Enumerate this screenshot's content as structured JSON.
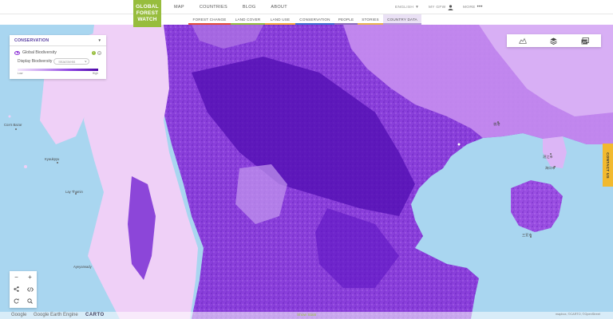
{
  "header": {
    "logo": [
      "GLOBAL",
      "FOREST",
      "WATCH"
    ],
    "nav": [
      "MAP",
      "COUNTRIES",
      "BLOG",
      "ABOUT"
    ],
    "right": {
      "language": "ENGLISH",
      "my_gfw": "MY GFW",
      "more": "MORE"
    }
  },
  "subnav": [
    {
      "label": "FOREST CHANGE",
      "color": "#e24d3a"
    },
    {
      "label": "LAND COVER",
      "color": "#97bd3d"
    },
    {
      "label": "LAND USE",
      "color": "#f3a93b"
    },
    {
      "label": "CONSERVATION",
      "color": "#3f6fd0"
    },
    {
      "label": "PEOPLE",
      "color": "#8b6fb8"
    },
    {
      "label": "STORIES",
      "color": "#e8b34f"
    },
    {
      "label": "COUNTRY DATA",
      "color": "#b59ad9"
    }
  ],
  "panel": {
    "title": "CONSERVATION",
    "layer_name": "Global Biodiversity",
    "display_label": "Display Biodiversity",
    "select_value": "Intactness",
    "legend": {
      "low": "Low",
      "high": "High"
    }
  },
  "contact": "CONTACT US",
  "footer": {
    "google": "Google",
    "earth_engine": "Google Earth Engine",
    "carto": "CARTO",
    "show_stats": "Show Stats",
    "attribution": "mapbox, ©CARTO, ©OpenStreet"
  },
  "map_labels": {
    "coxs_bazar": "Cox's Bazar",
    "kyaukpyu": "Kyaukpyu",
    "lay_thamin": "Lay Thamin",
    "ayeyarwady": "Ayeyarwady",
    "hong_kong": "香港",
    "zhanjiang": "湛江市",
    "haikou": "海口市",
    "sanya": "三亚市"
  },
  "colors": {
    "brand": "#97bd3d",
    "accent": "#5a3fa3",
    "water": "#a9d6f0",
    "biodiversity_high": "#5c12c0",
    "biodiversity_low": "#f1d6f8",
    "contact": "#f2b92e"
  },
  "icons": {
    "tools": [
      "analysis-icon",
      "layers-icon",
      "basemap-icon"
    ],
    "controls": [
      "zoom-out-icon",
      "zoom-in-icon",
      "share-icon",
      "embed-icon",
      "refresh-icon",
      "search-icon"
    ]
  }
}
